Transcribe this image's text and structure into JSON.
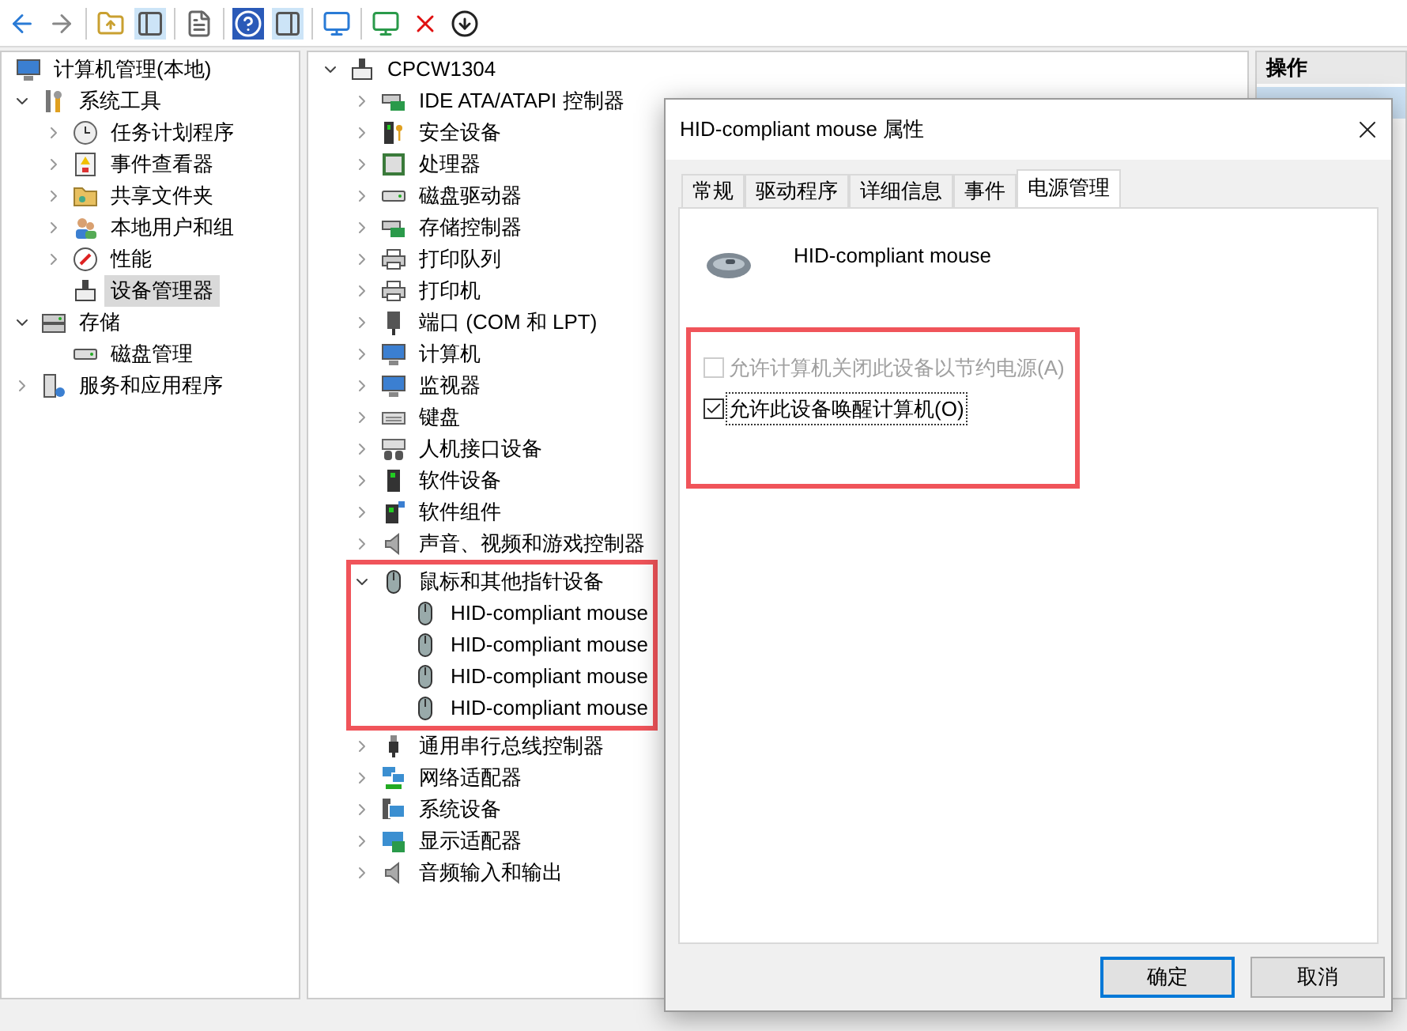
{
  "nav_tree": {
    "items": [
      {
        "label": "计算机管理(本地)",
        "selected": false,
        "children": [
          {
            "label": "系统工具",
            "expanded": true,
            "selected": false,
            "children": [
              {
                "label": "任务计划程序",
                "expanded": false,
                "selected": false
              },
              {
                "label": "事件查看器",
                "expanded": false,
                "selected": false
              },
              {
                "label": "共享文件夹",
                "expanded": false,
                "selected": false
              },
              {
                "label": "本地用户和组",
                "expanded": false,
                "selected": false
              },
              {
                "label": "性能",
                "expanded": false,
                "selected": false
              },
              {
                "label": "设备管理器",
                "selected": true
              }
            ]
          },
          {
            "label": "存储",
            "expanded": true,
            "selected": false,
            "children": [
              {
                "label": "磁盘管理",
                "selected": false
              }
            ]
          },
          {
            "label": "服务和应用程序",
            "expanded": false,
            "selected": false
          }
        ]
      }
    ]
  },
  "device_tree": {
    "items": [
      {
        "label": "CPCW1304",
        "expanded": true,
        "children": [
          {
            "label": "IDE ATA/ATAPI 控制器",
            "expanded": false
          },
          {
            "label": "安全设备",
            "expanded": false
          },
          {
            "label": "处理器",
            "expanded": false
          },
          {
            "label": "磁盘驱动器",
            "expanded": false
          },
          {
            "label": "存储控制器",
            "expanded": false
          },
          {
            "label": "打印队列",
            "expanded": false
          },
          {
            "label": "打印机",
            "expanded": false
          },
          {
            "label": "端口 (COM 和 LPT)",
            "expanded": false
          },
          {
            "label": "计算机",
            "expanded": false
          },
          {
            "label": "监视器",
            "expanded": false
          },
          {
            "label": "键盘",
            "expanded": false
          },
          {
            "label": "人机接口设备",
            "expanded": false
          },
          {
            "label": "软件设备",
            "expanded": false
          },
          {
            "label": "软件组件",
            "expanded": false
          },
          {
            "label": "声音、视频和游戏控制器",
            "expanded": false
          },
          {
            "label": "鼠标和其他指针设备",
            "expanded": true,
            "highlighted": true,
            "children": [
              {
                "label": "HID-compliant mouse"
              },
              {
                "label": "HID-compliant mouse"
              },
              {
                "label": "HID-compliant mouse"
              },
              {
                "label": "HID-compliant mouse"
              }
            ]
          },
          {
            "label": "通用串行总线控制器",
            "expanded": false
          },
          {
            "label": "网络适配器",
            "expanded": false
          },
          {
            "label": "系统设备",
            "expanded": false
          },
          {
            "label": "显示适配器",
            "expanded": false
          },
          {
            "label": "音频输入和输出",
            "expanded": false
          }
        ]
      }
    ]
  },
  "actions_pane": {
    "title": "操作"
  },
  "dialog": {
    "title": "HID-compliant mouse 属性",
    "tabs": [
      {
        "label": "常规",
        "selected": false
      },
      {
        "label": "驱动程序",
        "selected": false
      },
      {
        "label": "详细信息",
        "selected": false
      },
      {
        "label": "事件",
        "selected": false
      },
      {
        "label": "电源管理",
        "selected": true
      }
    ],
    "device_name": "HID-compliant mouse",
    "options_highlighted": true,
    "options": [
      {
        "label": "允许计算机关闭此设备以节约电源(A)",
        "checked": false,
        "disabled": true,
        "focused": false
      },
      {
        "label": "允许此设备唤醒计算机(O)",
        "checked": true,
        "disabled": false,
        "focused": true
      }
    ],
    "buttons": [
      {
        "label": "确定",
        "default": true
      },
      {
        "label": "取消",
        "default": false
      }
    ]
  }
}
